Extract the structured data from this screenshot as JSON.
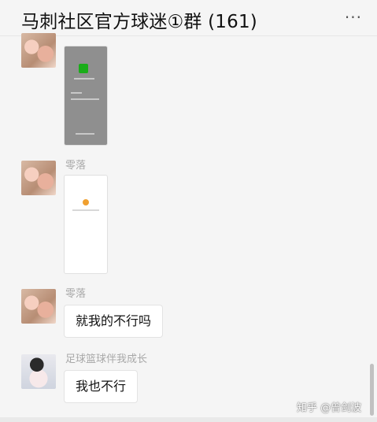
{
  "window": {
    "title": "马刺社区官方球迷①群 (161)",
    "more_label": "···"
  },
  "messages": [
    {
      "type": "image",
      "sender": "",
      "avatar": "pig-avatar"
    },
    {
      "type": "image",
      "sender": "零落",
      "avatar": "pig-avatar"
    },
    {
      "type": "text",
      "sender": "零落",
      "text": "就我的不行吗",
      "avatar": "pig-avatar"
    },
    {
      "type": "text",
      "sender": "足球篮球伴我成长",
      "text": "我也不行",
      "avatar": "anime-avatar"
    }
  ],
  "watermark": "知乎 @曾剑波"
}
